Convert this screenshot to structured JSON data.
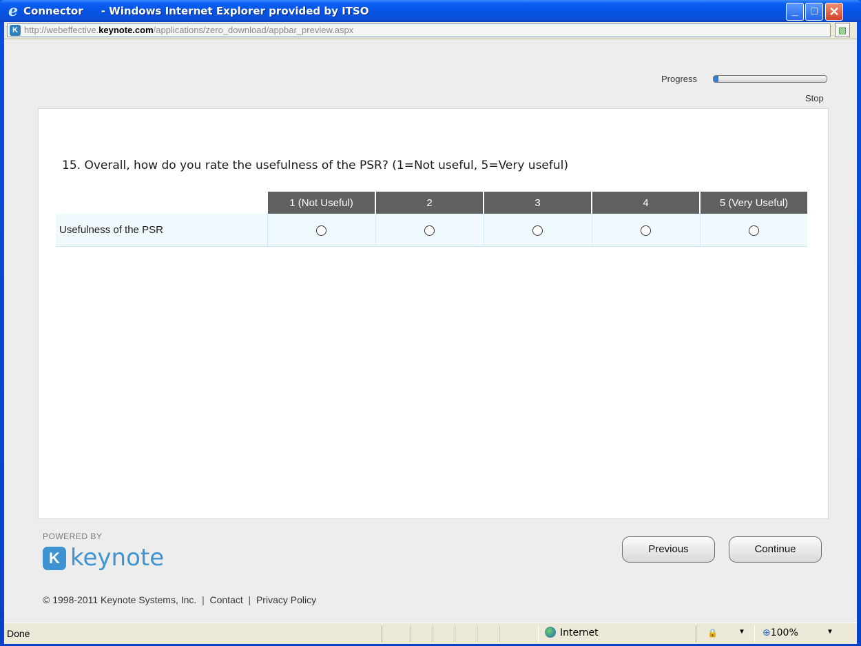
{
  "window": {
    "title": "Connector     - Windows Internet Explorer provided by ITSO",
    "url_prefix": "http://webeffective.",
    "url_domain": "keynote.com",
    "url_suffix": "/applications/zero_download/appbar_preview.aspx"
  },
  "toolbar": {
    "progress_label": "Progress",
    "progress_value": 0.04,
    "stop_label": "Stop"
  },
  "survey": {
    "question": "15. Overall, how do you rate the usefulness of the PSR? (1=Not useful, 5=Very useful)",
    "columns": [
      "1 (Not Useful)",
      "2",
      "3",
      "4",
      "5 (Very Useful)"
    ],
    "row_label": "Usefulness of the PSR",
    "selected": null
  },
  "branding": {
    "powered_by": "POWERED BY",
    "logo_mark": "K",
    "logo_text": "keynote",
    "color": "#3e94d0"
  },
  "nav": {
    "previous": "Previous",
    "continue": "Continue"
  },
  "footer": {
    "copyright": "© 1998-2011 Keynote Systems, Inc.",
    "sep": "|",
    "contact": "Contact",
    "privacy": "Privacy Policy"
  },
  "status": {
    "text": "Done",
    "zone": "Internet",
    "zoom": "100%"
  }
}
